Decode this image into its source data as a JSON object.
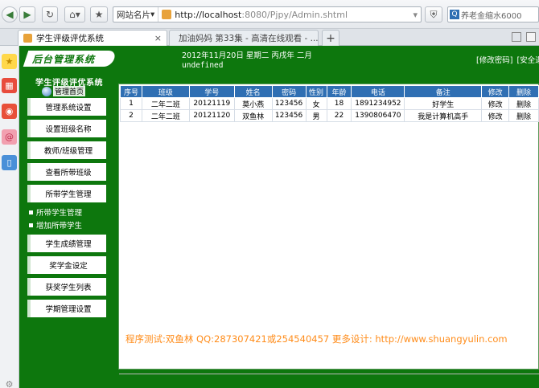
{
  "browser": {
    "site_menu_label": "网站名片",
    "url_host": "http://localhost",
    "url_rest": ":8080/Pjpy/Admin.shtml",
    "search_text": "养老金缩水6000",
    "tabs": [
      {
        "label": "学生评级评优系统",
        "close": "×"
      },
      {
        "label": "加油妈妈 第33集 - 高清在线观看 - ...",
        "close": "×"
      }
    ],
    "new_tab": "+"
  },
  "header": {
    "logo_text": "后台管理系统",
    "date_text": "2012年11月20日 星期二 丙戌年 二月",
    "user_text": "undefined",
    "links": [
      "[修改密码]",
      "[安全退"
    ]
  },
  "sidebar": {
    "title": "学生评级评优系统",
    "home_label": "管理首页",
    "items": [
      {
        "label": "管理系统设置"
      },
      {
        "label": "设置班级名称"
      },
      {
        "label": "教师/班级管理"
      },
      {
        "label": "查看所带班级"
      },
      {
        "label": "所带学生管理"
      }
    ],
    "subitems": [
      {
        "label": "所带学生管理"
      },
      {
        "label": "增加所带学生"
      }
    ],
    "items2": [
      {
        "label": "学生成绩管理"
      },
      {
        "label": "奖学金设定"
      },
      {
        "label": "获奖学生列表"
      },
      {
        "label": "学期管理设置"
      }
    ]
  },
  "table": {
    "headers": [
      "序号",
      "班级",
      "学号",
      "姓名",
      "密码",
      "性别",
      "年龄",
      "电话",
      "备注",
      "修改",
      "删除"
    ],
    "rows": [
      [
        "1",
        "二年二班",
        "20121119",
        "莫小燕",
        "123456",
        "女",
        "18",
        "1891234952",
        "好学生",
        "修改",
        "删除"
      ],
      [
        "2",
        "二年二班",
        "20121120",
        "双鱼林",
        "123456",
        "男",
        "22",
        "1390806470",
        "我是计算机高手",
        "修改",
        "删除"
      ]
    ]
  },
  "footer_note": "程序测试:双鱼林 QQ:287307421或254540457 更多设计: http://www.shuangyulin.com",
  "colors": {
    "brand_green": "#0d770d",
    "header_blue": "#2f6fb3",
    "note_orange": "#ff8c1a"
  }
}
